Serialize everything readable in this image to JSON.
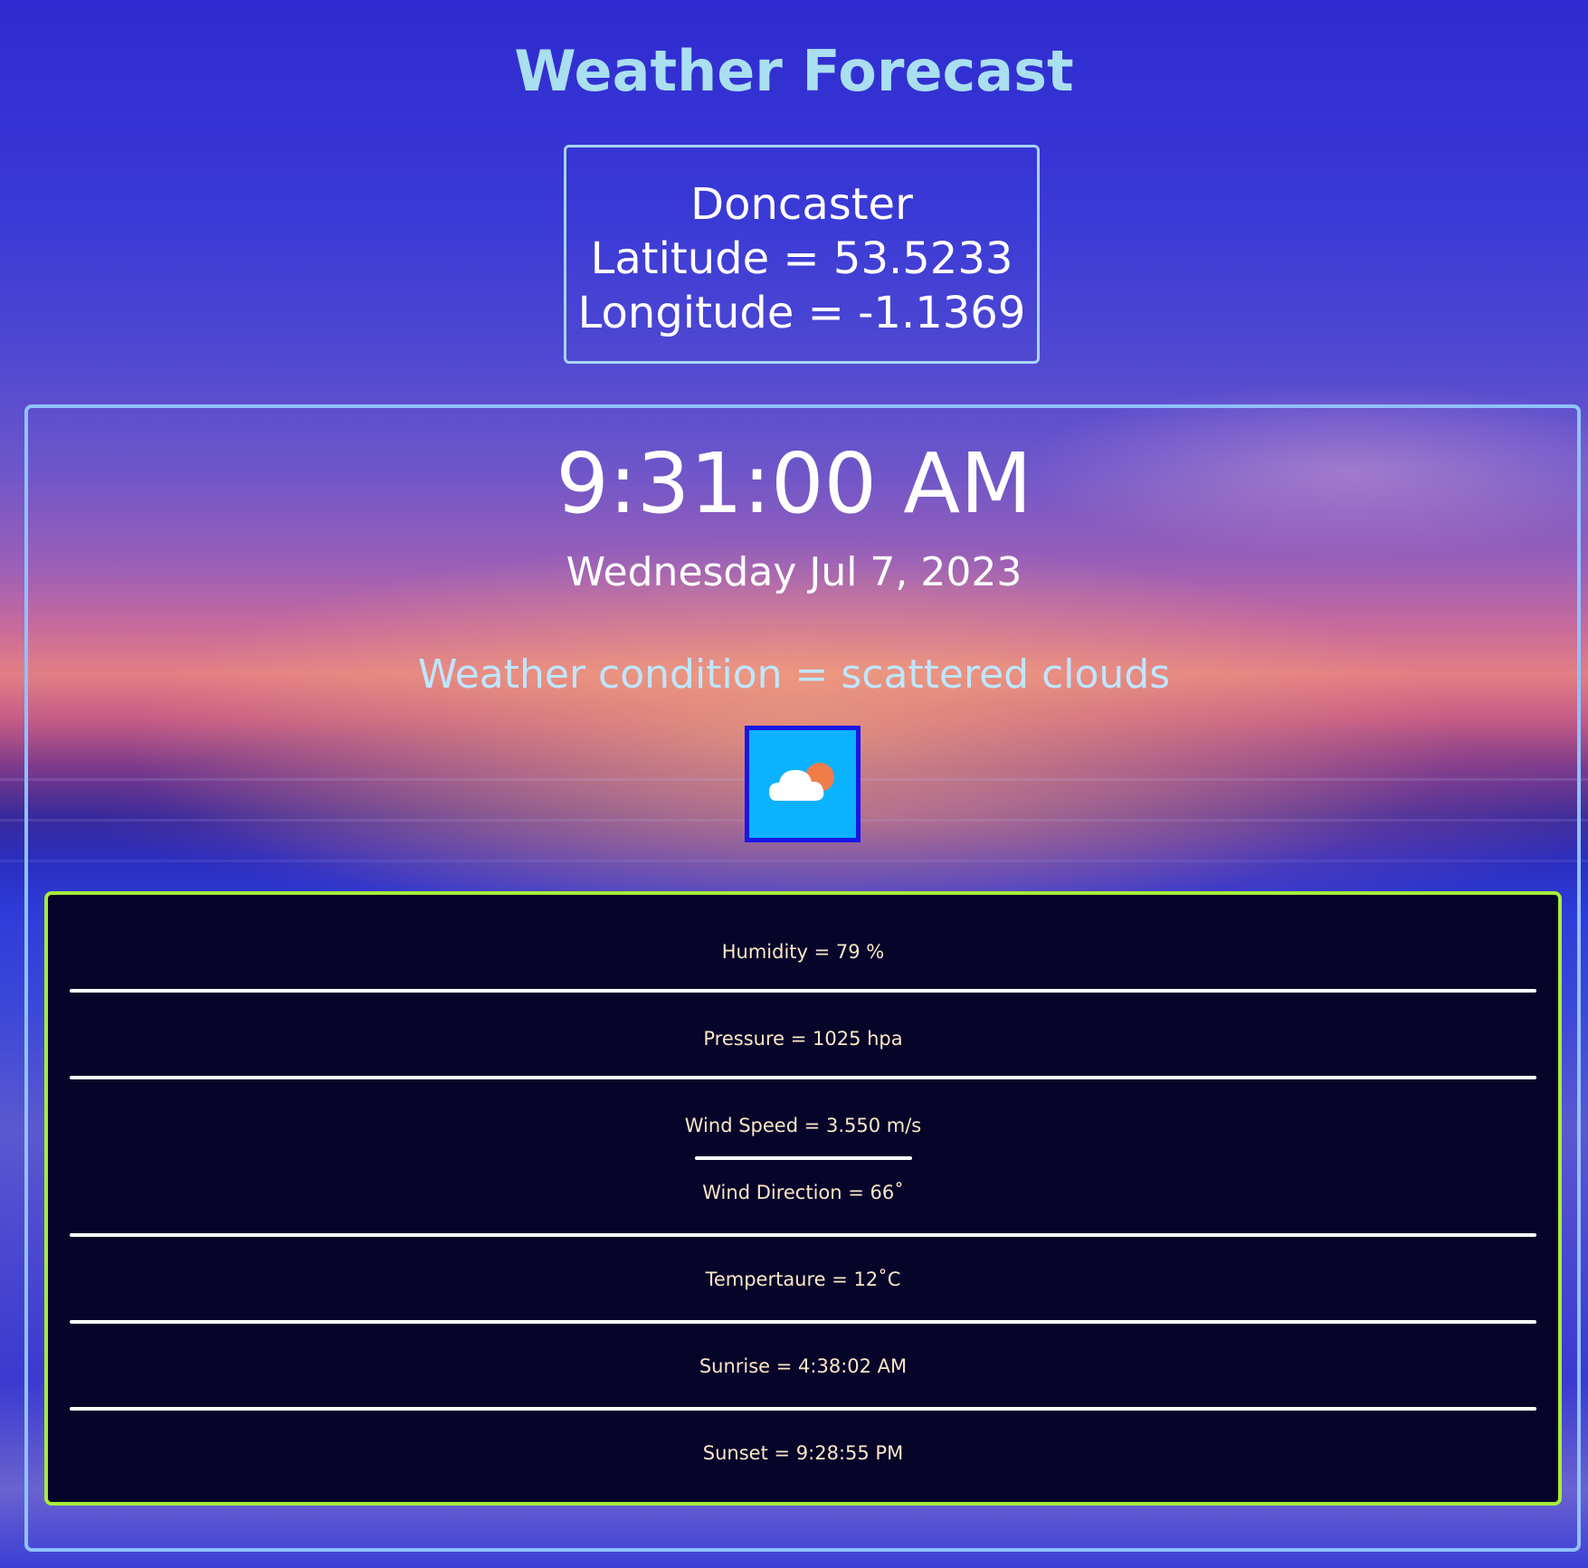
{
  "header": {
    "title": "Weather Forecast"
  },
  "location": {
    "city": "Doncaster",
    "latitude_text": "Latitude = 53.5233",
    "longitude_text": "Longitude = -1.1369"
  },
  "current": {
    "time": "9:31:00 AM",
    "date": "Wednesday Jul 7, 2023",
    "condition_text": "Weather condition = scattered clouds",
    "icon": "partly-cloudy-icon"
  },
  "details": {
    "humidity": "Humidity = 79 %",
    "pressure": "Pressure = 1025 hpa",
    "wind_speed": "Wind Speed = 3.550 m/s",
    "wind_direction": "Wind Direction = 66˚",
    "temperature": "Tempertaure = 12˚C",
    "sunrise": "Sunrise = 4:38:02 AM",
    "sunset": "Sunset = 9:28:55 PM"
  },
  "colors": {
    "title": "#a9dff0",
    "details_border": "#a6ec3a",
    "main_border": "#8fc1ff",
    "details_background": "#07042a",
    "icon_background": "#0bb3ff"
  }
}
